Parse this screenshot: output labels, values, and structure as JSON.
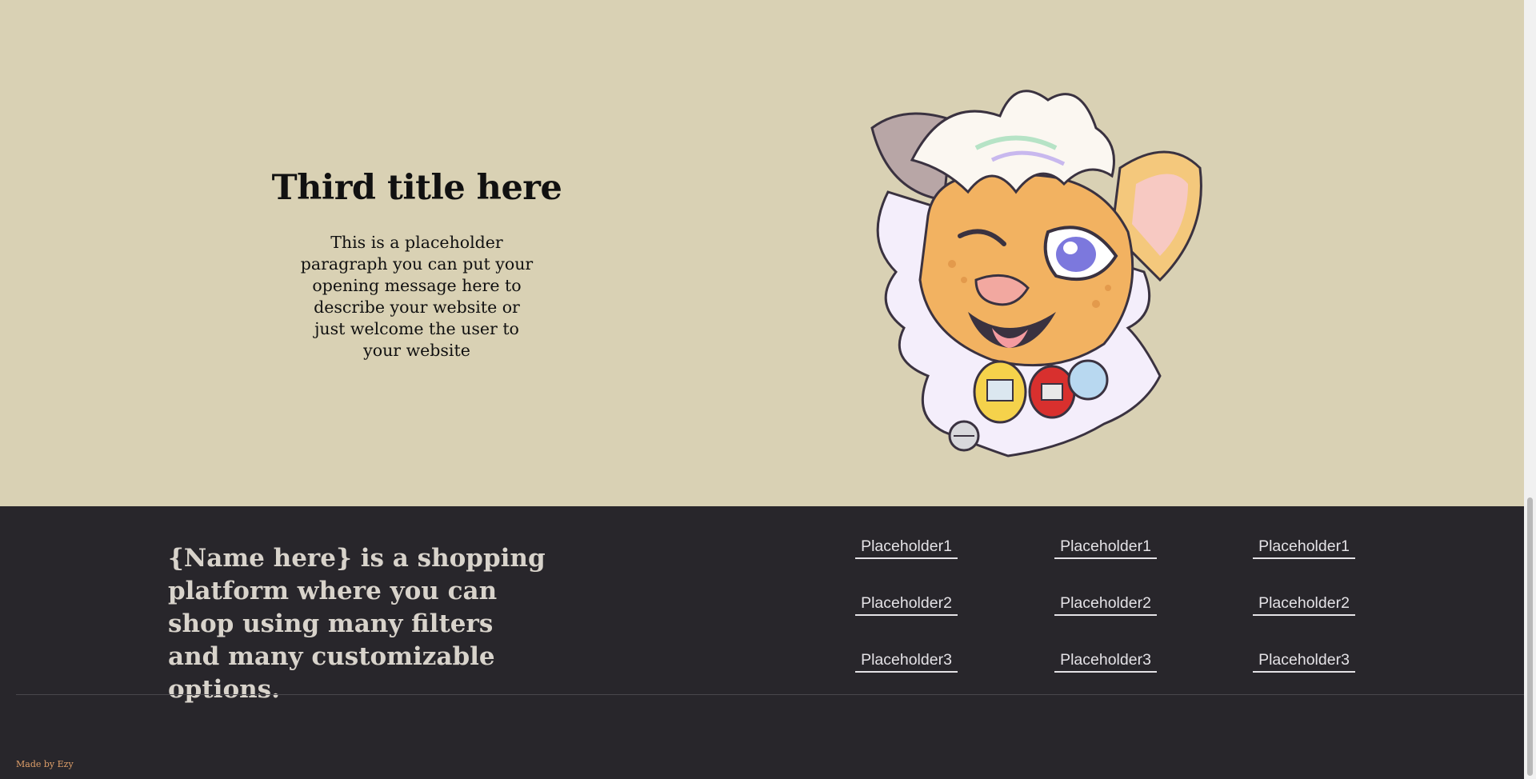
{
  "hero": {
    "title": "Third title here",
    "paragraph": "This is a placeholder paragraph you can put your opening message here to describe your website or just welcome the user to your website",
    "illustration_icon": "cartoon-lion-mascot-illustration"
  },
  "footer": {
    "tagline": "{Name here} is a shopping platform where you can shop using many filters and many customizable options.",
    "columns": [
      {
        "links": [
          "Placeholder1",
          "Placeholder2",
          "Placeholder3"
        ]
      },
      {
        "links": [
          "Placeholder1",
          "Placeholder2",
          "Placeholder3"
        ]
      },
      {
        "links": [
          "Placeholder1",
          "Placeholder2",
          "Placeholder3"
        ]
      }
    ],
    "made_by": "Made by Ezy"
  },
  "colors": {
    "hero_background": "#d9d1b4",
    "footer_background": "#28262b",
    "credit_accent": "#e0a06a"
  }
}
